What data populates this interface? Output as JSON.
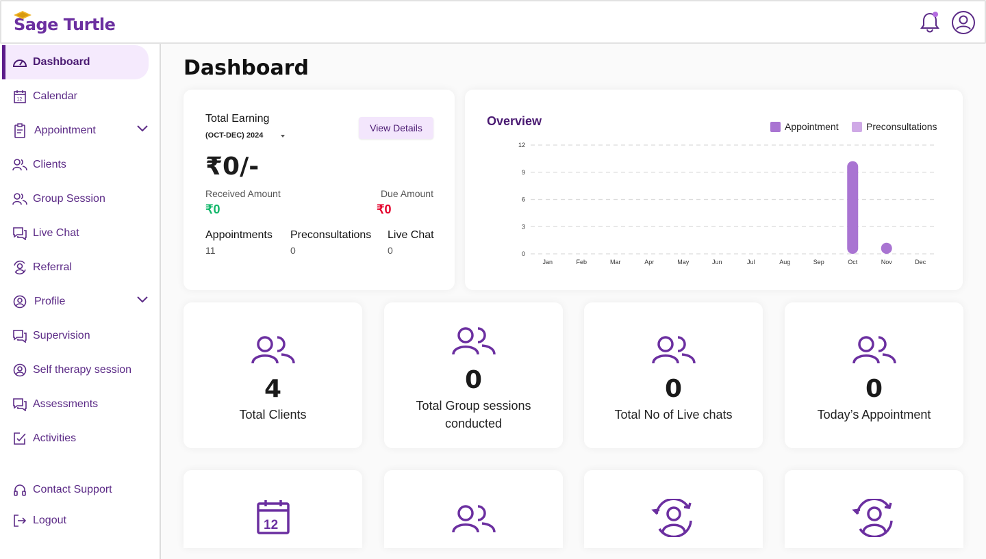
{
  "header": {
    "brand": "Sage Turtle",
    "notification_icon": "bell-icon",
    "account_icon": "user-circle-icon"
  },
  "sidebar": {
    "items": [
      {
        "label": "Dashboard",
        "icon": "gauge-icon",
        "active": true
      },
      {
        "label": "Calendar",
        "icon": "calendar-icon"
      },
      {
        "label": "Appointment",
        "icon": "clipboard-icon",
        "expandable": true
      },
      {
        "label": "Clients",
        "icon": "users-icon"
      },
      {
        "label": "Group Session",
        "icon": "users-icon"
      },
      {
        "label": "Live Chat",
        "icon": "chat-icon"
      },
      {
        "label": "Referral",
        "icon": "referral-icon"
      },
      {
        "label": "Profile",
        "icon": "user-circle-icon",
        "expandable": true
      },
      {
        "label": "Supervision",
        "icon": "chat-icon"
      },
      {
        "label": "Self therapy session",
        "icon": "user-circle-icon"
      },
      {
        "label": "Assessments",
        "icon": "chat-icon"
      },
      {
        "label": "Activities",
        "icon": "checkbox-icon"
      }
    ],
    "bottom": [
      {
        "label": "Contact Support",
        "icon": "headphones-icon"
      },
      {
        "label": "Logout",
        "icon": "logout-icon"
      }
    ]
  },
  "main": {
    "title": "Dashboard",
    "earning": {
      "title": "Total Earning",
      "period": "(OCT-DEC) 2024",
      "view_details": "View Details",
      "amount": "₹0/-",
      "received_label": "Received Amount",
      "received_value": "₹0",
      "due_label": "Due Amount",
      "due_value": "₹0",
      "stats": [
        {
          "label": "Appointments",
          "value": "11"
        },
        {
          "label": "Preconsultations",
          "value": "0"
        },
        {
          "label": "Live Chat",
          "value": "0"
        }
      ]
    },
    "overview": {
      "title": "Overview",
      "legend": [
        {
          "label": "Appointment",
          "color": "#a974d2"
        },
        {
          "label": "Preconsultations",
          "color": "#cfa9e6"
        }
      ]
    },
    "stat_cards": [
      {
        "number": "4",
        "label": "Total Clients",
        "icon": "users-icon"
      },
      {
        "number": "0",
        "label": "Total Group sessions conducted",
        "icon": "users-icon"
      },
      {
        "number": "0",
        "label": "Total No of Live chats",
        "icon": "users-icon"
      },
      {
        "number": "0",
        "label": "Today’s Appointment",
        "icon": "users-icon"
      }
    ],
    "bottom_cards": [
      {
        "icon": "calendar-icon"
      },
      {
        "icon": "users-icon"
      },
      {
        "icon": "referral-icon"
      },
      {
        "icon": "referral-icon"
      }
    ]
  },
  "colors": {
    "primary": "#6b2fa0",
    "active_bg": "#f5eafd",
    "positive": "#12b76a",
    "negative": "#e4002b"
  },
  "chart_data": {
    "type": "bar",
    "title": "Overview",
    "categories": [
      "Jan",
      "Feb",
      "Mar",
      "Apr",
      "May",
      "Jun",
      "Jul",
      "Aug",
      "Sep",
      "Oct",
      "Nov",
      "Dec"
    ],
    "series": [
      {
        "name": "Appointment",
        "values": [
          0,
          0,
          0,
          0,
          0,
          0,
          0,
          0,
          0,
          10,
          1,
          0
        ]
      },
      {
        "name": "Preconsultations",
        "values": [
          0,
          0,
          0,
          0,
          0,
          0,
          0,
          0,
          0,
          0,
          0,
          0
        ]
      }
    ],
    "yticks": [
      "0",
      "3",
      "6",
      "9",
      "12"
    ],
    "ylim": [
      0,
      12
    ],
    "grid": true,
    "legend": "top-right"
  }
}
